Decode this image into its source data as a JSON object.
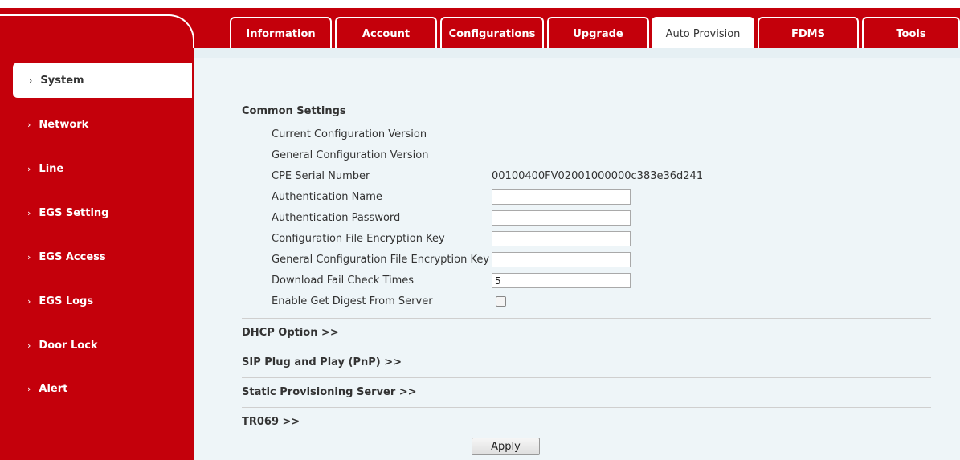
{
  "tabs": [
    {
      "label": "Information"
    },
    {
      "label": "Account"
    },
    {
      "label": "Configurations"
    },
    {
      "label": "Upgrade"
    },
    {
      "label": "Auto Provision",
      "active": true
    },
    {
      "label": "FDMS"
    },
    {
      "label": "Tools"
    }
  ],
  "sidebar": {
    "chevron": "›",
    "items": [
      {
        "label": "System",
        "active": true
      },
      {
        "label": "Network"
      },
      {
        "label": "Line"
      },
      {
        "label": "EGS Setting"
      },
      {
        "label": "EGS Access"
      },
      {
        "label": "EGS Logs"
      },
      {
        "label": "Door Lock"
      },
      {
        "label": "Alert"
      }
    ]
  },
  "common": {
    "title": "Common Settings",
    "current_config_version_label": "Current Configuration Version",
    "general_config_version_label": "General Configuration Version",
    "cpe_serial_label": "CPE Serial Number",
    "cpe_serial_value": "00100400FV02001000000c383e36d241",
    "auth_name_label": "Authentication Name",
    "auth_name_value": "",
    "auth_password_label": "Authentication Password",
    "auth_password_value": "",
    "config_encryption_label": "Configuration File Encryption Key",
    "config_encryption_value": "",
    "general_encryption_label": "General Configuration File Encryption Key",
    "general_encryption_value": "",
    "download_fail_label": "Download Fail Check Times",
    "download_fail_value": "5",
    "digest_label": "Enable Get Digest From Server",
    "digest_checked": false
  },
  "sections": {
    "dhcp": "DHCP Option >>",
    "pnp": "SIP Plug and Play (PnP) >>",
    "static": "Static Provisioning Server >>",
    "tr069": "TR069 >>"
  },
  "apply_label": "Apply",
  "colors": {
    "brand": "#c4000b",
    "panel": "#eef5f8"
  }
}
